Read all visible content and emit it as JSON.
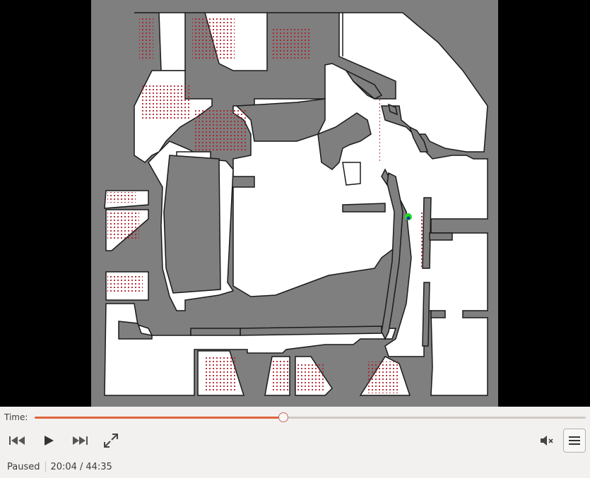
{
  "video": {
    "background": "#000000",
    "map_colors": {
      "unknown": "#7f7f7f",
      "free": "#ffffff",
      "wall": "#1a1a1a",
      "particle": "#b0202a",
      "robot_outer": "#22dd22",
      "robot_inner": "#1a3aa0"
    }
  },
  "controls": {
    "time_label": "Time:",
    "progress": 0.4509,
    "accent": "#e0643c",
    "status": "Paused",
    "position": "20:04",
    "separator": "/",
    "duration": "44:35",
    "icons": [
      "skip-back-icon",
      "play-icon",
      "skip-forward-icon",
      "fullscreen-icon",
      "volume-muted-icon",
      "menu-icon"
    ]
  }
}
